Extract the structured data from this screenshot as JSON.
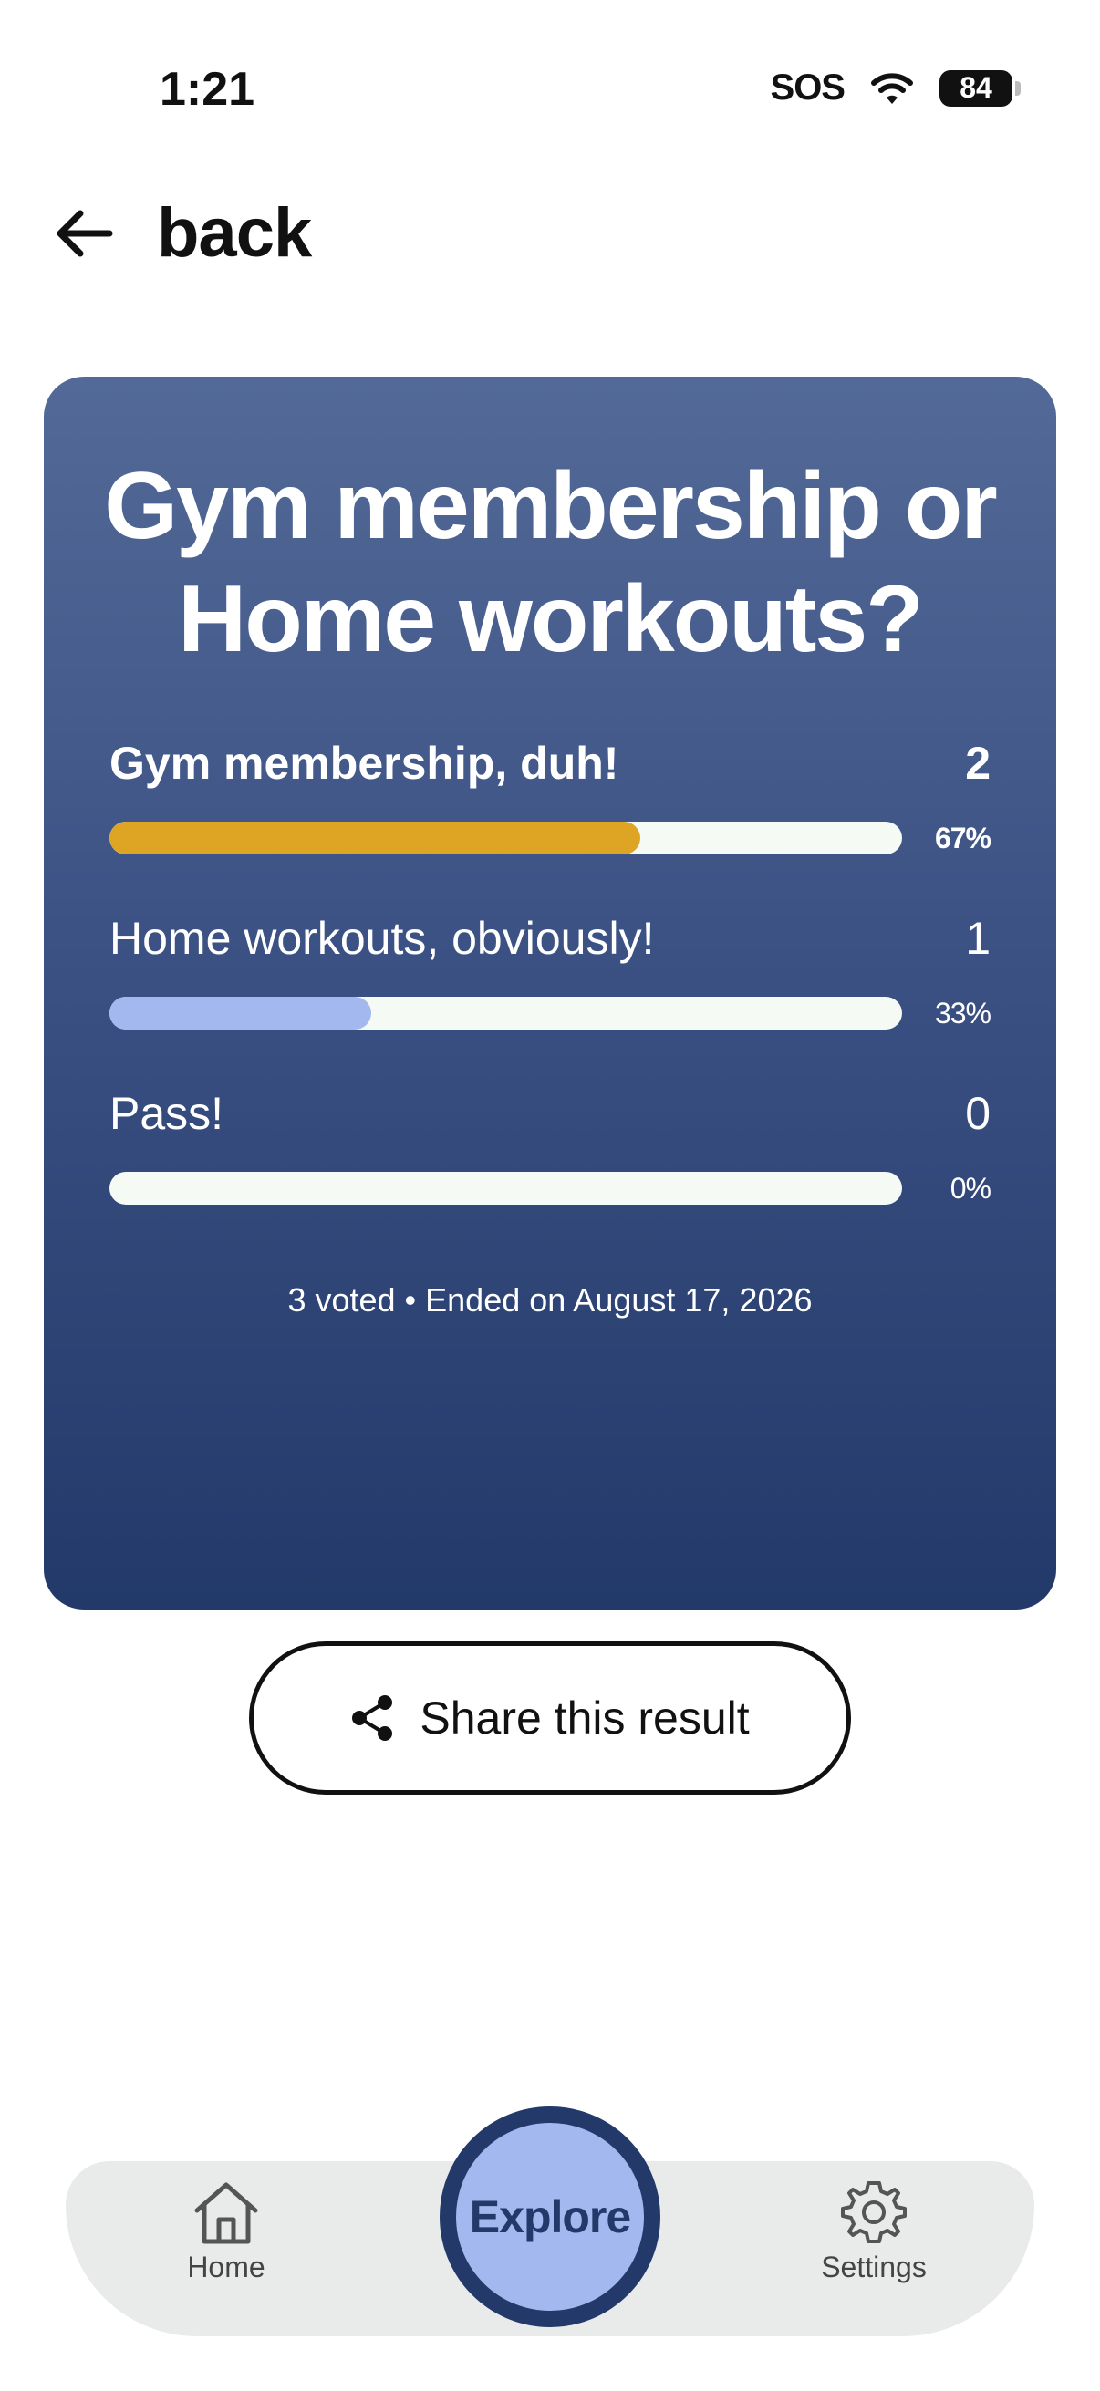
{
  "status_bar": {
    "time": "1:21",
    "sos": "SOS",
    "battery": "84"
  },
  "header": {
    "back_label": "back"
  },
  "poll": {
    "question": "Gym membership or Home workouts?",
    "options": [
      {
        "label": "Gym membership, duh!",
        "count": "2",
        "percent": "67%",
        "fraction": 0.67,
        "color": "#dea424",
        "bold": true
      },
      {
        "label": "Home workouts, obviously!",
        "count": "1",
        "percent": "33%",
        "fraction": 0.33,
        "color": "#a3b8ef",
        "bold": false
      },
      {
        "label": "Pass!",
        "count": "0",
        "percent": "0%",
        "fraction": 0,
        "color": "#a3b8ef",
        "bold": false
      }
    ],
    "meta": "3 voted • Ended on August 17, 2026"
  },
  "share": {
    "label": "Share this result"
  },
  "nav": {
    "home_label": "Home",
    "explore_label": "Explore",
    "settings_label": "Settings"
  },
  "colors": {
    "card_top": "#536a98",
    "card_bottom": "#22396a",
    "accent_gold": "#dea424",
    "accent_blue": "#a3b8ef",
    "navy": "#22396a"
  }
}
